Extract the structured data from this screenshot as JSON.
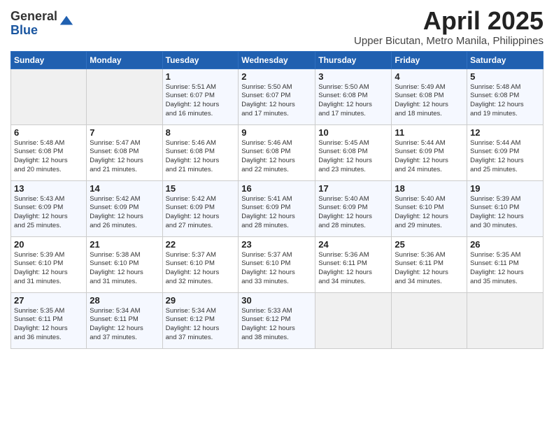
{
  "logo": {
    "general": "General",
    "blue": "Blue"
  },
  "title": "April 2025",
  "location": "Upper Bicutan, Metro Manila, Philippines",
  "weekdays": [
    "Sunday",
    "Monday",
    "Tuesday",
    "Wednesday",
    "Thursday",
    "Friday",
    "Saturday"
  ],
  "weeks": [
    [
      {
        "day": "",
        "info": ""
      },
      {
        "day": "",
        "info": ""
      },
      {
        "day": "1",
        "info": "Sunrise: 5:51 AM\nSunset: 6:07 PM\nDaylight: 12 hours\nand 16 minutes."
      },
      {
        "day": "2",
        "info": "Sunrise: 5:50 AM\nSunset: 6:07 PM\nDaylight: 12 hours\nand 17 minutes."
      },
      {
        "day": "3",
        "info": "Sunrise: 5:50 AM\nSunset: 6:08 PM\nDaylight: 12 hours\nand 17 minutes."
      },
      {
        "day": "4",
        "info": "Sunrise: 5:49 AM\nSunset: 6:08 PM\nDaylight: 12 hours\nand 18 minutes."
      },
      {
        "day": "5",
        "info": "Sunrise: 5:48 AM\nSunset: 6:08 PM\nDaylight: 12 hours\nand 19 minutes."
      }
    ],
    [
      {
        "day": "6",
        "info": "Sunrise: 5:48 AM\nSunset: 6:08 PM\nDaylight: 12 hours\nand 20 minutes."
      },
      {
        "day": "7",
        "info": "Sunrise: 5:47 AM\nSunset: 6:08 PM\nDaylight: 12 hours\nand 21 minutes."
      },
      {
        "day": "8",
        "info": "Sunrise: 5:46 AM\nSunset: 6:08 PM\nDaylight: 12 hours\nand 21 minutes."
      },
      {
        "day": "9",
        "info": "Sunrise: 5:46 AM\nSunset: 6:08 PM\nDaylight: 12 hours\nand 22 minutes."
      },
      {
        "day": "10",
        "info": "Sunrise: 5:45 AM\nSunset: 6:08 PM\nDaylight: 12 hours\nand 23 minutes."
      },
      {
        "day": "11",
        "info": "Sunrise: 5:44 AM\nSunset: 6:09 PM\nDaylight: 12 hours\nand 24 minutes."
      },
      {
        "day": "12",
        "info": "Sunrise: 5:44 AM\nSunset: 6:09 PM\nDaylight: 12 hours\nand 25 minutes."
      }
    ],
    [
      {
        "day": "13",
        "info": "Sunrise: 5:43 AM\nSunset: 6:09 PM\nDaylight: 12 hours\nand 25 minutes."
      },
      {
        "day": "14",
        "info": "Sunrise: 5:42 AM\nSunset: 6:09 PM\nDaylight: 12 hours\nand 26 minutes."
      },
      {
        "day": "15",
        "info": "Sunrise: 5:42 AM\nSunset: 6:09 PM\nDaylight: 12 hours\nand 27 minutes."
      },
      {
        "day": "16",
        "info": "Sunrise: 5:41 AM\nSunset: 6:09 PM\nDaylight: 12 hours\nand 28 minutes."
      },
      {
        "day": "17",
        "info": "Sunrise: 5:40 AM\nSunset: 6:09 PM\nDaylight: 12 hours\nand 28 minutes."
      },
      {
        "day": "18",
        "info": "Sunrise: 5:40 AM\nSunset: 6:10 PM\nDaylight: 12 hours\nand 29 minutes."
      },
      {
        "day": "19",
        "info": "Sunrise: 5:39 AM\nSunset: 6:10 PM\nDaylight: 12 hours\nand 30 minutes."
      }
    ],
    [
      {
        "day": "20",
        "info": "Sunrise: 5:39 AM\nSunset: 6:10 PM\nDaylight: 12 hours\nand 31 minutes."
      },
      {
        "day": "21",
        "info": "Sunrise: 5:38 AM\nSunset: 6:10 PM\nDaylight: 12 hours\nand 31 minutes."
      },
      {
        "day": "22",
        "info": "Sunrise: 5:37 AM\nSunset: 6:10 PM\nDaylight: 12 hours\nand 32 minutes."
      },
      {
        "day": "23",
        "info": "Sunrise: 5:37 AM\nSunset: 6:10 PM\nDaylight: 12 hours\nand 33 minutes."
      },
      {
        "day": "24",
        "info": "Sunrise: 5:36 AM\nSunset: 6:11 PM\nDaylight: 12 hours\nand 34 minutes."
      },
      {
        "day": "25",
        "info": "Sunrise: 5:36 AM\nSunset: 6:11 PM\nDaylight: 12 hours\nand 34 minutes."
      },
      {
        "day": "26",
        "info": "Sunrise: 5:35 AM\nSunset: 6:11 PM\nDaylight: 12 hours\nand 35 minutes."
      }
    ],
    [
      {
        "day": "27",
        "info": "Sunrise: 5:35 AM\nSunset: 6:11 PM\nDaylight: 12 hours\nand 36 minutes."
      },
      {
        "day": "28",
        "info": "Sunrise: 5:34 AM\nSunset: 6:11 PM\nDaylight: 12 hours\nand 37 minutes."
      },
      {
        "day": "29",
        "info": "Sunrise: 5:34 AM\nSunset: 6:12 PM\nDaylight: 12 hours\nand 37 minutes."
      },
      {
        "day": "30",
        "info": "Sunrise: 5:33 AM\nSunset: 6:12 PM\nDaylight: 12 hours\nand 38 minutes."
      },
      {
        "day": "",
        "info": ""
      },
      {
        "day": "",
        "info": ""
      },
      {
        "day": "",
        "info": ""
      }
    ]
  ]
}
